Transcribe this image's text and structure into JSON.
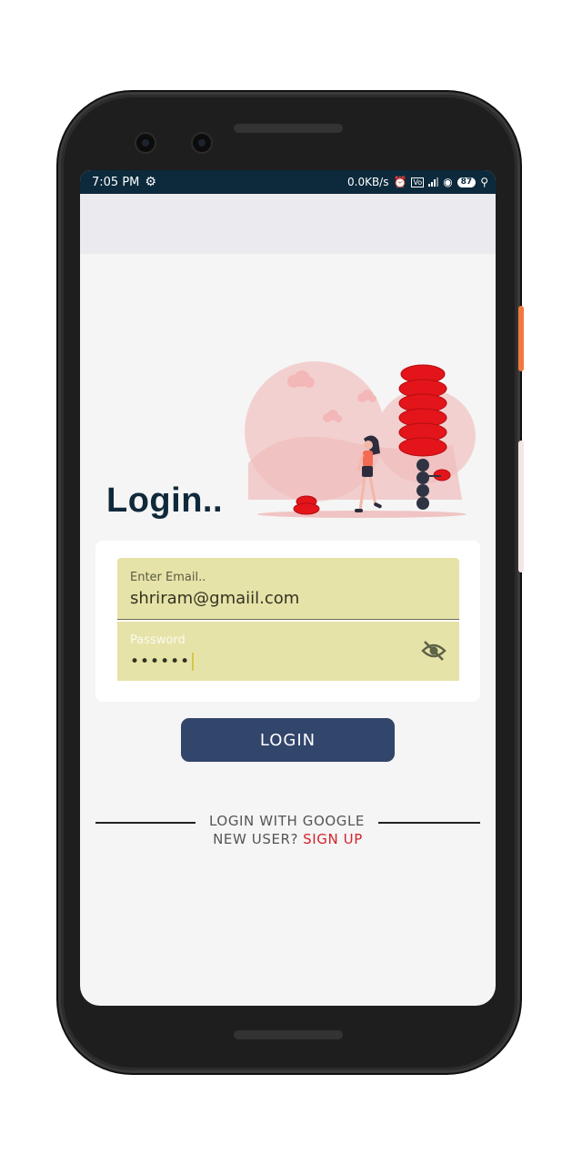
{
  "status_bar": {
    "time": "7:05 PM",
    "network_speed": "0.0KB/s",
    "battery": "87",
    "settings_icon": "gear-icon"
  },
  "login": {
    "title": "Login..",
    "email_label": "Enter Email..",
    "email_value": "shriram@gmaiil.com",
    "password_label": "Password",
    "password_value": "••••••",
    "visibility_icon": "eye-off-icon",
    "button_label": "LOGIN",
    "google_label": "LOGIN WITH GOOGLE",
    "new_user_label": "NEW USER?",
    "signup_label": "SIGN UP"
  },
  "colors": {
    "status_bar": "#0c2a3c",
    "title": "#10293a",
    "field_bg": "#e6e3a8",
    "button": "#32456b",
    "signup_link": "#d3232d"
  }
}
